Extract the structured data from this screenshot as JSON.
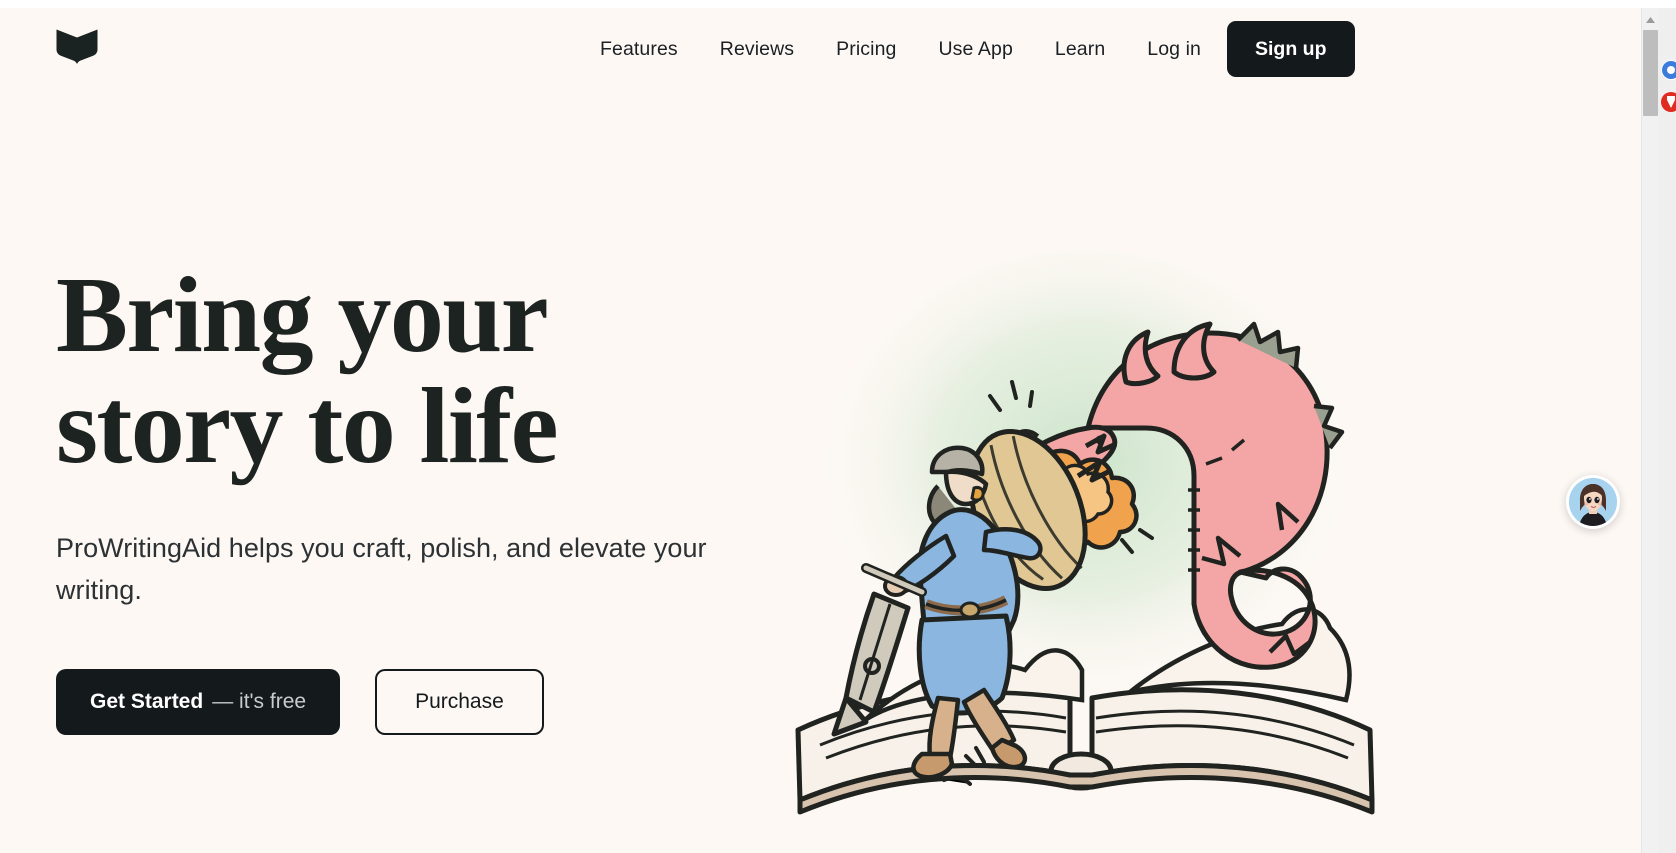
{
  "brand": {
    "logo_icon": "open-book-logo",
    "accent_dark": "#14191b",
    "background": "#fdf8f4"
  },
  "header": {
    "nav": [
      {
        "label": "Features",
        "name": "features"
      },
      {
        "label": "Reviews",
        "name": "reviews"
      },
      {
        "label": "Pricing",
        "name": "pricing"
      },
      {
        "label": "Use App",
        "name": "use-app"
      },
      {
        "label": "Learn",
        "name": "learn"
      }
    ],
    "login_label": "Log in",
    "signup_label": "Sign up"
  },
  "hero": {
    "title_line_1": "Bring your",
    "title_line_2": "story to life",
    "subtitle": "ProWritingAid helps you craft, polish, and elevate your writing.",
    "primary_cta": {
      "label": "Get Started",
      "suffix": "— it's free"
    },
    "secondary_cta": {
      "label": "Purchase"
    },
    "illustration": "knight-fighting-dragon-on-open-book"
  },
  "chat_widget": {
    "icon": "support-agent-avatar"
  },
  "browser": {
    "scrollbar": {
      "up_arrow_icon": "caret-up-icon",
      "thumb": "scroll-thumb"
    },
    "extensions": [
      {
        "icon": "blue-extension-icon",
        "color": "#3b7ddd"
      },
      {
        "icon": "red-extension-icon",
        "color": "#e02b20"
      }
    ]
  }
}
